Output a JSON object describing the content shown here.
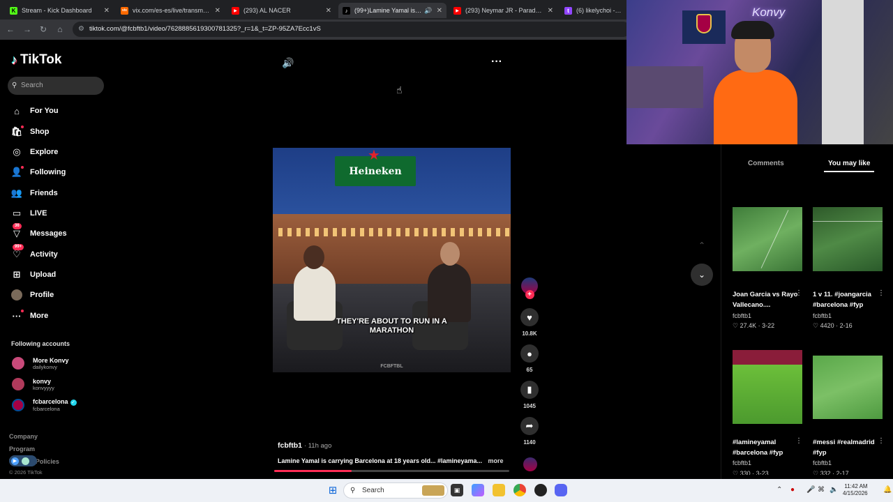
{
  "browser": {
    "tabs": [
      {
        "title": "Stream - Kick Dashboard",
        "fav_color": "#53fc18",
        "fav_letter": "K"
      },
      {
        "title": "vix.com/es-es/live/transmision",
        "fav_color": "#ff6a00",
        "fav_letter": "vix"
      },
      {
        "title": "(293) AL NACER",
        "fav_color": "#ff0000",
        "fav_letter": "▶"
      },
      {
        "title": "(99+)Lamine Yamal is carry",
        "fav_color": "#000000",
        "fav_letter": "♪"
      },
      {
        "title": "(293) Neymar JR - Parado no b",
        "fav_color": "#ff0000",
        "fav_letter": "▶"
      },
      {
        "title": "(6) likelychoi - Twitch",
        "fav_color": "#9146ff",
        "fav_letter": "t"
      }
    ],
    "url": "tiktok.com/@fcbftb1/video/7628885619300781325?_r=1&_t=ZP-95ZA7Ecc1vS"
  },
  "sidebar": {
    "logo": "TikTok",
    "search_placeholder": "Search",
    "nav": [
      {
        "label": "For You",
        "icon": "home-icon",
        "glyph": "⌂"
      },
      {
        "label": "Shop",
        "icon": "shop-icon",
        "glyph": "🛍"
      },
      {
        "label": "Explore",
        "icon": "explore-icon",
        "glyph": "◎"
      },
      {
        "label": "Following",
        "icon": "following-icon",
        "glyph": "👤"
      },
      {
        "label": "Friends",
        "icon": "friends-icon",
        "glyph": "👥"
      },
      {
        "label": "LIVE",
        "icon": "live-icon",
        "glyph": "▭"
      },
      {
        "label": "Messages",
        "icon": "messages-icon",
        "glyph": "▽",
        "badge": "36"
      },
      {
        "label": "Activity",
        "icon": "activity-icon",
        "glyph": "♡",
        "badge": "99+"
      },
      {
        "label": "Upload",
        "icon": "upload-icon",
        "glyph": "⊞"
      },
      {
        "label": "Profile",
        "icon": "profile-icon",
        "glyph": "●"
      },
      {
        "label": "More",
        "icon": "more-icon",
        "glyph": "···"
      }
    ],
    "following_title": "Following accounts",
    "accounts": [
      {
        "name": "More Konvy",
        "handle": "dailykonvy",
        "color": "#c94a7a"
      },
      {
        "name": "konvy",
        "handle": "konvyyyy",
        "color": "#b03a5b"
      },
      {
        "name": "fcbarcelona",
        "handle": "fcbarcelona",
        "color": "#a50044",
        "verified": true
      }
    ],
    "footer": [
      "Company",
      "Program",
      "Terms & Policies"
    ],
    "copyright": "© 2026 TikTok"
  },
  "video": {
    "sponsor": "Heineken",
    "caption_line1": "THEY'RE ABOUT TO RUN IN A",
    "caption_line2": "MARATHON",
    "watermark": "FCBFTBL",
    "likes": "10.8K",
    "comments": "65",
    "saves": "1045",
    "shares": "1140",
    "author": "fcbftb1",
    "posted": "· 11h ago",
    "description": "Lamine Yamal is carrying Barcelona at 18 years old... #lamineyama...",
    "more": "more",
    "progress": 0.33
  },
  "right_panel": {
    "tabs": [
      "Comments",
      "You may like"
    ],
    "active_tab": "You may like",
    "cards": [
      {
        "title": "Joan Garcia vs Rayo Vallecano....",
        "user": "fcbftb1",
        "likes": "27.4K",
        "date": "3-22"
      },
      {
        "title": "1 v 11. #joangarcia #barcelona #fyp",
        "user": "fcbftb1",
        "likes": "4420",
        "date": "2-16"
      },
      {
        "title": "#lamineyamal #barcelona #fyp",
        "user": "fcbftb1",
        "likes": "330",
        "date": "3-23"
      },
      {
        "title": "#messi #realmadrid #fyp",
        "user": "fcbftb1",
        "likes": "332",
        "date": "2-17"
      }
    ]
  },
  "taskbar": {
    "search": "Search",
    "time": "11:42 AM",
    "date": "4/15/2026"
  }
}
